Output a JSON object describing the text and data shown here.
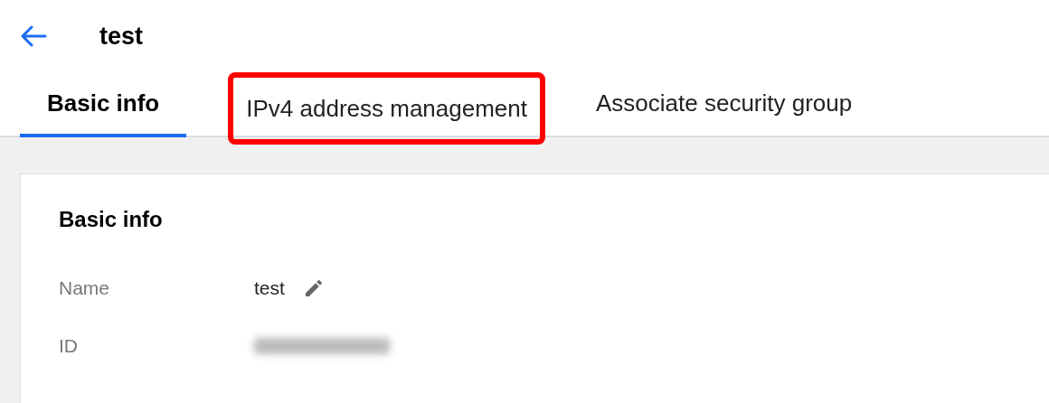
{
  "header": {
    "title": "test"
  },
  "tabs": [
    {
      "label": "Basic info",
      "selected": true,
      "highlighted": false
    },
    {
      "label": "IPv4 address management",
      "selected": false,
      "highlighted": true
    },
    {
      "label": "Associate security group",
      "selected": false,
      "highlighted": false
    }
  ],
  "card": {
    "title": "Basic info",
    "fields": [
      {
        "label": "Name",
        "value": "test",
        "editable": true,
        "redacted": false
      },
      {
        "label": "ID",
        "editable": false,
        "redacted": true
      }
    ]
  }
}
